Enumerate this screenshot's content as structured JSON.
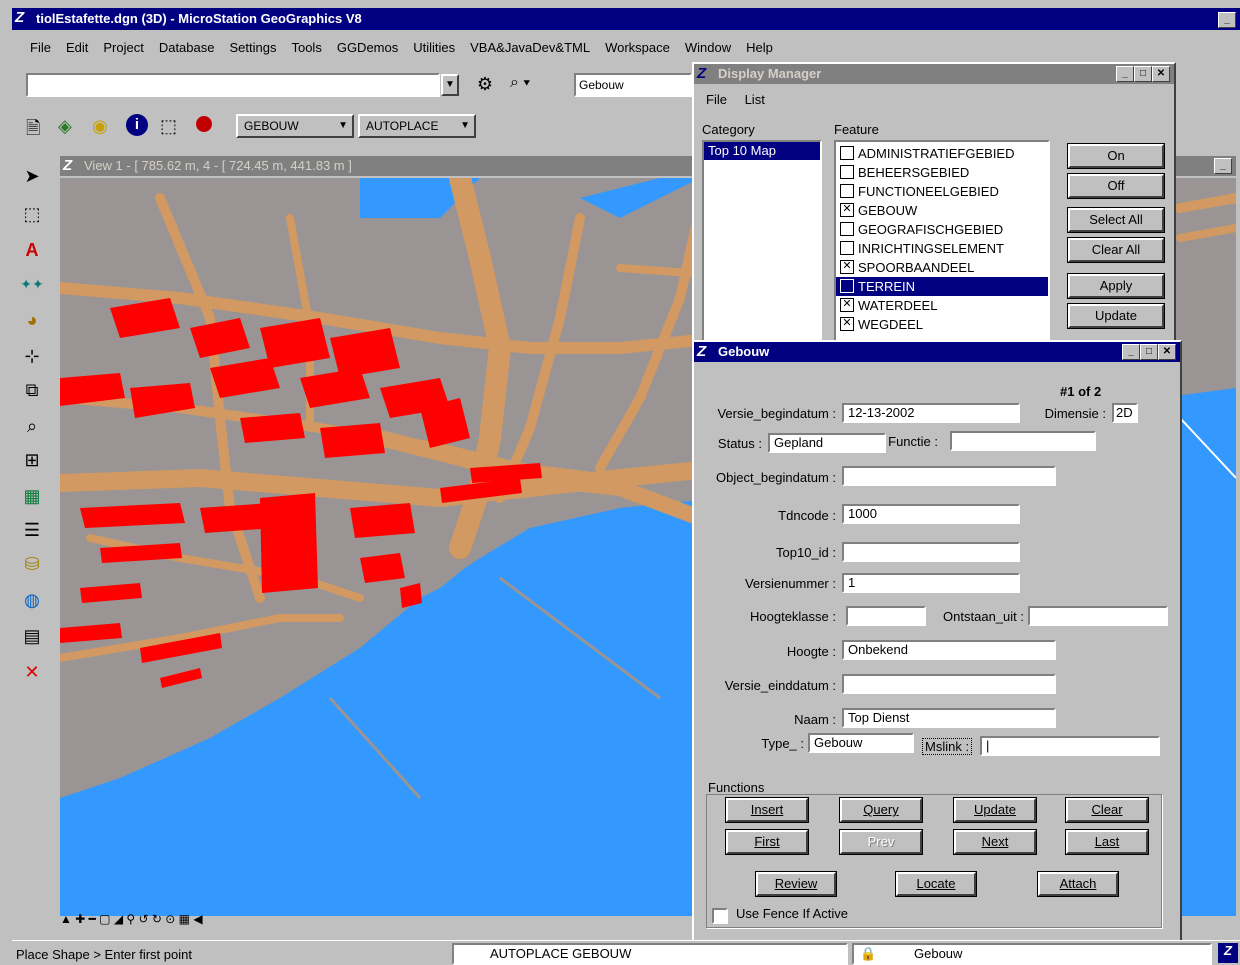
{
  "app": {
    "title": "tiolEstafette.dgn (3D) - MicroStation GeoGraphics V8",
    "menu": [
      "File",
      "Edit",
      "Project",
      "Database",
      "Settings",
      "Tools",
      "GGDemos",
      "Utilities",
      "VBA&JavaDev&TML",
      "Workspace",
      "Window",
      "Help"
    ],
    "toolbar_combo": "Gebouw",
    "feature_combo": "GEBOUW",
    "placement_combo": "AUTOPLACE"
  },
  "view": {
    "title": "View 1 - [ 785.62 m, 4 - [ 724.45 m, 441.83 m ]"
  },
  "status": {
    "prompt": "Place Shape > Enter first point",
    "mode": "AUTOPLACE GEBOUW",
    "feature": "Gebouw"
  },
  "display_manager": {
    "title": "Display Manager",
    "menu": [
      "File",
      "List"
    ],
    "category_label": "Category",
    "feature_label": "Feature",
    "categories": [
      "Top 10 Map"
    ],
    "features": [
      {
        "name": "ADMINISTRATIEFGEBIED",
        "checked": false,
        "selected": false
      },
      {
        "name": "BEHEERSGEBIED",
        "checked": false,
        "selected": false
      },
      {
        "name": "FUNCTIONEELGEBIED",
        "checked": false,
        "selected": false
      },
      {
        "name": "GEBOUW",
        "checked": true,
        "selected": false
      },
      {
        "name": "GEOGRAFISCHGEBIED",
        "checked": false,
        "selected": false
      },
      {
        "name": "INRICHTINGSELEMENT",
        "checked": false,
        "selected": false
      },
      {
        "name": "SPOORBAANDEEL",
        "checked": true,
        "selected": false
      },
      {
        "name": "TERREIN",
        "checked": false,
        "selected": true
      },
      {
        "name": "WATERDEEL",
        "checked": true,
        "selected": false
      },
      {
        "name": "WEGDEEL",
        "checked": true,
        "selected": false
      }
    ],
    "buttons": {
      "on": "On",
      "off": "Off",
      "select_all": "Select All",
      "clear_all": "Clear All",
      "apply": "Apply",
      "update": "Update"
    }
  },
  "gebouw_form": {
    "title": "Gebouw",
    "record": "#1 of 2",
    "labels": {
      "versie_begindatum": "Versie_begindatum :",
      "dimensie": "Dimensie :",
      "status": "Status :",
      "functie": "Functie :",
      "object_begindatum": "Object_begindatum :",
      "tdncode": "Tdncode :",
      "top10_id": "Top10_id :",
      "versienummer": "Versienummer :",
      "hoogteklasse": "Hoogteklasse :",
      "ontstaan_uit": "Ontstaan_uit :",
      "hoogte": "Hoogte :",
      "versie_einddatum": "Versie_einddatum :",
      "naam": "Naam :",
      "type": "Type_ :",
      "mslink": "Mslink :"
    },
    "values": {
      "versie_begindatum": "12-13-2002",
      "dimensie": "2D",
      "status": "Gepland",
      "functie": "",
      "object_begindatum": "",
      "tdncode": "1000",
      "top10_id": "",
      "versienummer": "1",
      "hoogteklasse": "",
      "ontstaan_uit": "",
      "hoogte": "Onbekend",
      "versie_einddatum": "",
      "naam": "Top Dienst",
      "type": "Gebouw",
      "mslink": "|"
    },
    "functions_label": "Functions",
    "buttons": {
      "insert": "Insert",
      "query": "Query",
      "update": "Update",
      "clear": "Clear",
      "first": "First",
      "prev": "Prev",
      "next": "Next",
      "last": "Last",
      "review": "Review",
      "locate": "Locate",
      "attach": "Attach"
    },
    "fence_label": "Use Fence If Active"
  },
  "colors": {
    "water": "#3399ff",
    "land": "#9a9494",
    "roads": "#d29a62",
    "buildings": "#ff0000",
    "title_active": "#000080"
  }
}
